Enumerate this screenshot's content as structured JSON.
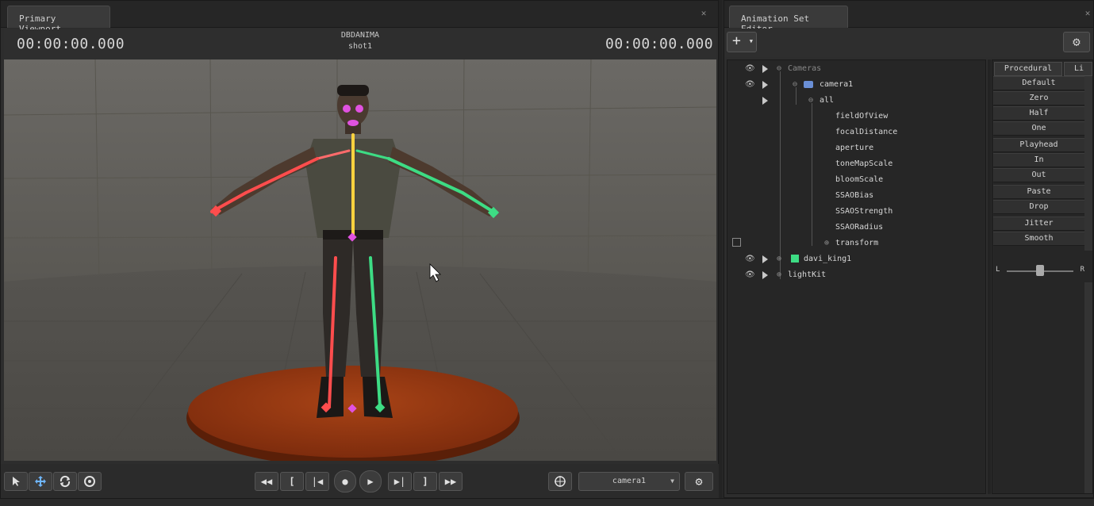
{
  "viewport": {
    "tab_label": "Primary Viewport",
    "timecode_left": "00:00:00.000",
    "timecode_right": "00:00:00.000",
    "session_name": "DBDANIMA",
    "shot_name": "shot1",
    "camera_select": "camera1"
  },
  "animation_set_editor": {
    "tab_label": "Animation Set Editor",
    "tree": [
      {
        "label": "Cameras",
        "level": 0,
        "visible_eye": true,
        "dim": true
      },
      {
        "label": "camera1",
        "level": 1,
        "visible_eye": true,
        "icon": "camera-icon"
      },
      {
        "label": "all",
        "level": 2,
        "visible_eye": false
      },
      {
        "label": "fieldOfView",
        "level": 3
      },
      {
        "label": "focalDistance",
        "level": 3
      },
      {
        "label": "aperture",
        "level": 3
      },
      {
        "label": "toneMapScale",
        "level": 3
      },
      {
        "label": "bloomScale",
        "level": 3
      },
      {
        "label": "SSAOBias",
        "level": 3
      },
      {
        "label": "SSAOStrength",
        "level": 3
      },
      {
        "label": "SSAORadius",
        "level": 3
      },
      {
        "label": "transform",
        "level": 3
      },
      {
        "label": "davi_king1",
        "level": 0,
        "visible_eye": true,
        "icon": "model-icon"
      },
      {
        "label": "lightKit",
        "level": 0,
        "visible_eye": true
      }
    ]
  },
  "procedural": {
    "tabs": [
      "Procedural",
      "Li"
    ],
    "buttons": [
      "Default",
      "Zero",
      "Half",
      "One",
      "Playhead",
      "In",
      "Out",
      "Paste",
      "Drop",
      "Jitter",
      "Smooth"
    ],
    "slider_left": "L",
    "slider_right": "R",
    "slider_value": 0.5
  },
  "colors": {
    "accent_green": "#3ddc84",
    "bone_red": "#ff4d4d",
    "bone_yellow": "#ffd23f",
    "bone_pink": "#e052e0",
    "floor_disc": "#9a3a14"
  },
  "icons": {
    "select": "arrow-pointer-icon",
    "move": "move-arrows-icon",
    "rotate": "rotate-icon",
    "scale": "scale-circle-icon",
    "rewind": "rewind-icon",
    "prev_key": "bracket-left-icon",
    "start": "skip-start-icon",
    "record": "record-icon",
    "play": "play-icon",
    "end": "skip-end-icon",
    "next_key": "bracket-right-icon",
    "ffwd": "fast-forward-icon",
    "target": "crosshair-icon",
    "settings": "gear-icon"
  }
}
